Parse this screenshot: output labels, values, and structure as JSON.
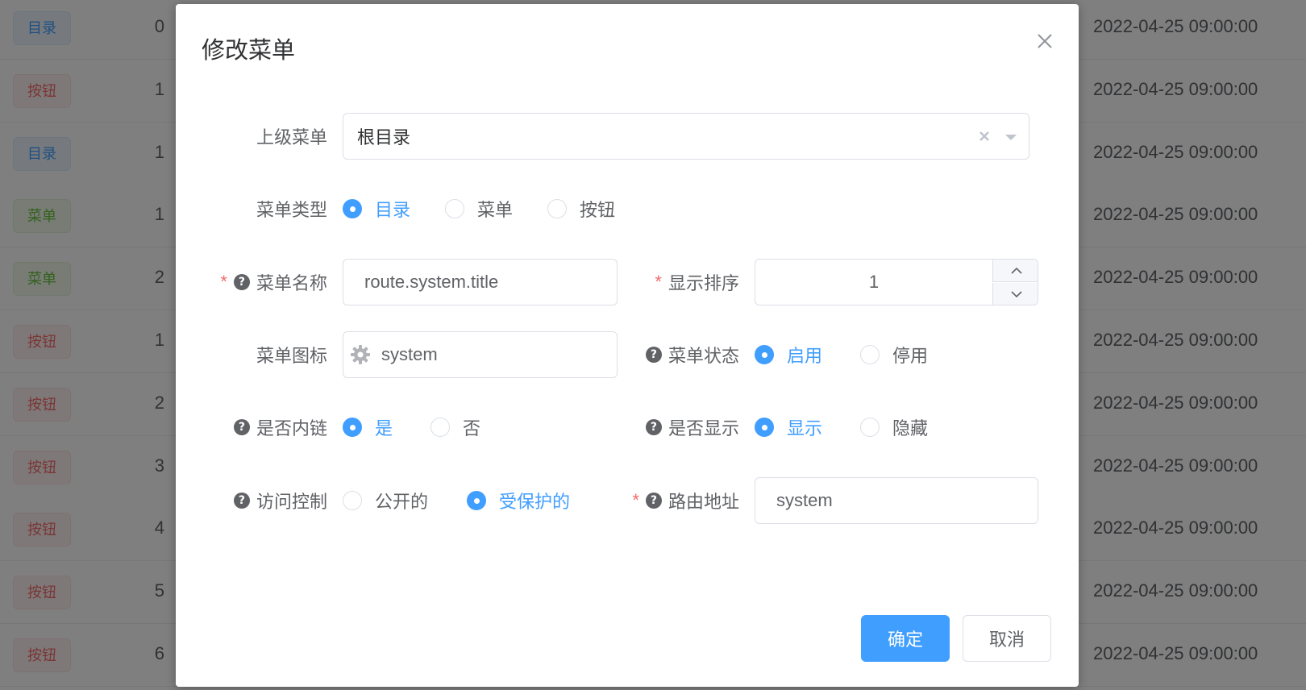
{
  "background_table": {
    "rows": [
      {
        "type": "目录",
        "kind": "dir",
        "sort": "0",
        "time": "2022-04-25 09:00:00"
      },
      {
        "type": "按钮",
        "kind": "btn",
        "sort": "1",
        "time": "2022-04-25 09:00:00"
      },
      {
        "type": "目录",
        "kind": "dir",
        "sort": "1",
        "time": "2022-04-25 09:00:00"
      },
      {
        "type": "菜单",
        "kind": "menu",
        "sort": "1",
        "time": "2022-04-25 09:00:00"
      },
      {
        "type": "菜单",
        "kind": "menu",
        "sort": "2",
        "time": "2022-04-25 09:00:00"
      },
      {
        "type": "按钮",
        "kind": "btn",
        "sort": "1",
        "time": "2022-04-25 09:00:00"
      },
      {
        "type": "按钮",
        "kind": "btn",
        "sort": "2",
        "time": "2022-04-25 09:00:00"
      },
      {
        "type": "按钮",
        "kind": "btn",
        "sort": "3",
        "time": "2022-04-25 09:00:00"
      },
      {
        "type": "按钮",
        "kind": "btn",
        "sort": "4",
        "time": "2022-04-25 09:00:00"
      },
      {
        "type": "按钮",
        "kind": "btn",
        "sort": "5",
        "time": "2022-04-25 09:00:00"
      },
      {
        "type": "按钮",
        "kind": "btn",
        "sort": "6",
        "time": "2022-04-25 09:00:00"
      }
    ]
  },
  "dialog": {
    "title": "修改菜单",
    "form": {
      "parent": {
        "label": "上级菜单",
        "value": "根目录"
      },
      "menu_type": {
        "label": "菜单类型",
        "options": [
          "目录",
          "菜单",
          "按钮"
        ],
        "selected": "目录"
      },
      "menu_name": {
        "label": "菜单名称",
        "required_mark": "*",
        "value": "route.system.title"
      },
      "sort_order": {
        "label": "显示排序",
        "required_mark": "*",
        "value": "1"
      },
      "menu_icon": {
        "label": "菜单图标",
        "value": "system",
        "icon": "gear-icon"
      },
      "menu_status": {
        "label": "菜单状态",
        "options": [
          "启用",
          "停用"
        ],
        "selected": "启用"
      },
      "is_frame": {
        "label": "是否内链",
        "options": [
          "是",
          "否"
        ],
        "selected": "是"
      },
      "visible": {
        "label": "是否显示",
        "options": [
          "显示",
          "隐藏"
        ],
        "selected": "显示"
      },
      "access": {
        "label": "访问控制",
        "options": [
          "公开的",
          "受保护的"
        ],
        "selected": "受保护的"
      },
      "route_path": {
        "label": "路由地址",
        "required_mark": "*",
        "value": "system"
      }
    },
    "help_glyph": "?",
    "confirm_label": "确定",
    "cancel_label": "取消"
  },
  "colors": {
    "primary": "#409eff",
    "danger": "#f56c6c",
    "success": "#67c23a"
  }
}
